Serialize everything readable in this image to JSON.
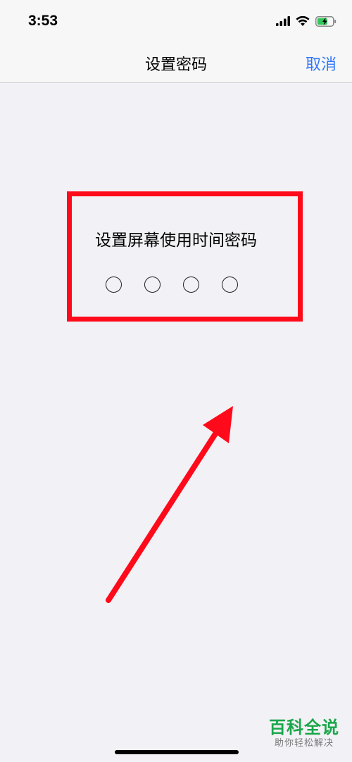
{
  "status_bar": {
    "time": "3:53",
    "icons": [
      "cellular-signal-icon",
      "wifi-icon",
      "battery-charging-icon"
    ]
  },
  "nav": {
    "title": "设置密码",
    "cancel_label": "取消"
  },
  "passcode": {
    "prompt": "设置屏幕使用时间密码",
    "digit_count": 4,
    "entered": 0
  },
  "annotation": {
    "highlight_color": "#ff0a1a",
    "arrow_color": "#ff0a1a"
  },
  "watermark": {
    "title": "百科全说",
    "subtitle": "助你轻松解决"
  },
  "colors": {
    "background": "#f2f1f6",
    "link": "#3478f6"
  }
}
